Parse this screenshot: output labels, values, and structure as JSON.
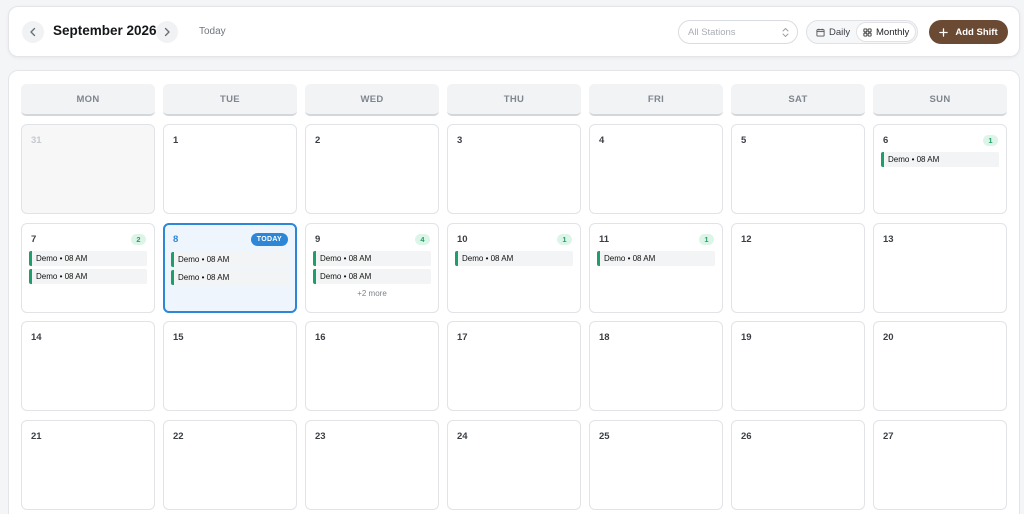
{
  "header": {
    "month_title": "September 2026",
    "today_label": "Today",
    "station_placeholder": "All Stations",
    "view_daily": "Daily",
    "view_monthly": "Monthly",
    "active_view": "Monthly",
    "add_shift_label": "Add Shift"
  },
  "colors": {
    "accent_brown": "#6b4a33",
    "today_blue": "#2e86d6",
    "event_green": "#1f9d6a"
  },
  "weekdays": [
    "MON",
    "TUE",
    "WED",
    "THU",
    "FRI",
    "SAT",
    "SUN"
  ],
  "today_badge": "TODAY",
  "weeks": [
    [
      {
        "day": "31",
        "other_month": true
      },
      {
        "day": "1"
      },
      {
        "day": "2"
      },
      {
        "day": "3"
      },
      {
        "day": "4"
      },
      {
        "day": "5"
      },
      {
        "day": "6",
        "count": "1",
        "events": [
          "Demo • 08 AM"
        ]
      }
    ],
    [
      {
        "day": "7",
        "count": "2",
        "events": [
          "Demo • 08 AM",
          "Demo • 08 AM"
        ]
      },
      {
        "day": "8",
        "today": true,
        "events": [
          "Demo • 08 AM",
          "Demo • 08 AM"
        ]
      },
      {
        "day": "9",
        "count": "4",
        "events": [
          "Demo • 08 AM",
          "Demo • 08 AM"
        ],
        "more": "+2 more"
      },
      {
        "day": "10",
        "count": "1",
        "events": [
          "Demo • 08 AM"
        ]
      },
      {
        "day": "11",
        "count": "1",
        "events": [
          "Demo • 08 AM"
        ]
      },
      {
        "day": "12"
      },
      {
        "day": "13"
      }
    ],
    [
      {
        "day": "14"
      },
      {
        "day": "15"
      },
      {
        "day": "16"
      },
      {
        "day": "17"
      },
      {
        "day": "18"
      },
      {
        "day": "19"
      },
      {
        "day": "20"
      }
    ],
    [
      {
        "day": "21"
      },
      {
        "day": "22"
      },
      {
        "day": "23"
      },
      {
        "day": "24"
      },
      {
        "day": "25"
      },
      {
        "day": "26"
      },
      {
        "day": "27"
      }
    ]
  ]
}
